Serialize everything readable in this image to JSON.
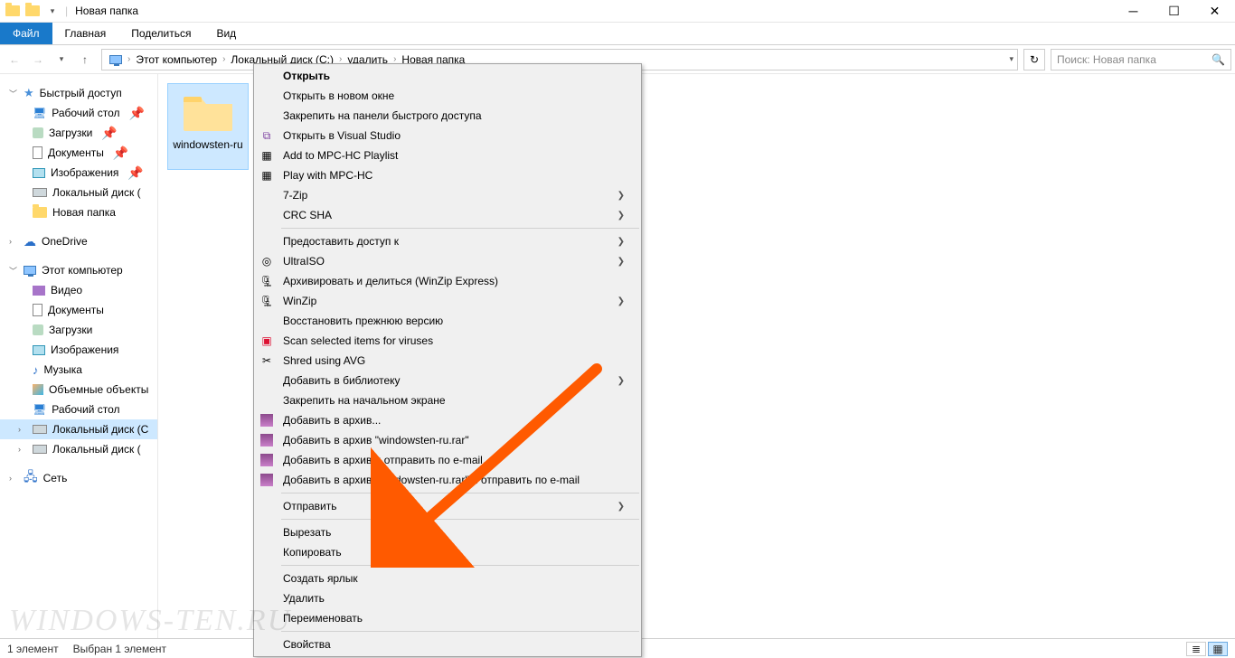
{
  "titlebar": {
    "title": "Новая папка"
  },
  "ribbon": {
    "file": "Файл",
    "home": "Главная",
    "share": "Поделиться",
    "view": "Вид"
  },
  "breadcrumb": {
    "pc": "Этот компьютер",
    "c": "Локальный диск (C:)",
    "del": "удалить",
    "folder": "Новая папка"
  },
  "search": {
    "placeholder": "Поиск: Новая папка"
  },
  "sidebar": {
    "quick": "Быстрый доступ",
    "desktop": "Рабочий стол",
    "downloads": "Загрузки",
    "documents": "Документы",
    "pictures": "Изображения",
    "localdisk": "Локальный диск (",
    "newfolder": "Новая папка",
    "onedrive": "OneDrive",
    "thispc": "Этот компьютер",
    "videos": "Видео",
    "documents2": "Документы",
    "downloads2": "Загрузки",
    "pictures2": "Изображения",
    "music": "Музыка",
    "objects3d": "Объемные объекты",
    "desktop2": "Рабочий стол",
    "localc": "Локальный диск (C",
    "locald": "Локальный диск (",
    "network": "Сеть"
  },
  "content": {
    "folder_name": "windowsten-ru"
  },
  "menu": {
    "open": "Открыть",
    "open_new": "Открыть в новом окне",
    "pin_quick": "Закрепить на панели быстрого доступа",
    "open_vs": "Открыть в Visual Studio",
    "add_mpc": "Add to MPC-HC Playlist",
    "play_mpc": "Play with MPC-HC",
    "sevenzip": "7-Zip",
    "crc": "CRC SHA",
    "share_access": "Предоставить доступ к",
    "ultraiso": "UltraISO",
    "winzip_exp": "Архивировать и делиться (WinZip Express)",
    "winzip": "WinZip",
    "restore": "Восстановить прежнюю версию",
    "scan": "Scan selected items for viruses",
    "shred": "Shred using AVG",
    "add_lib": "Добавить в библиотеку",
    "pin_start": "Закрепить на начальном экране",
    "add_arch": "Добавить в архив...",
    "add_rar": "Добавить в архив \"windowsten-ru.rar\"",
    "arch_mail": "Добавить в архив и отправить по e-mail...",
    "arch_rar_mail": "Добавить в архив \"windowsten-ru.rar\" и отправить по e-mail",
    "send_to": "Отправить",
    "cut": "Вырезать",
    "copy": "Копировать",
    "shortcut": "Создать ярлык",
    "delete": "Удалить",
    "rename": "Переименовать",
    "properties": "Свойства"
  },
  "status": {
    "count": "1 элемент",
    "selected": "Выбран 1 элемент"
  },
  "watermark": "windows-ten.ru"
}
